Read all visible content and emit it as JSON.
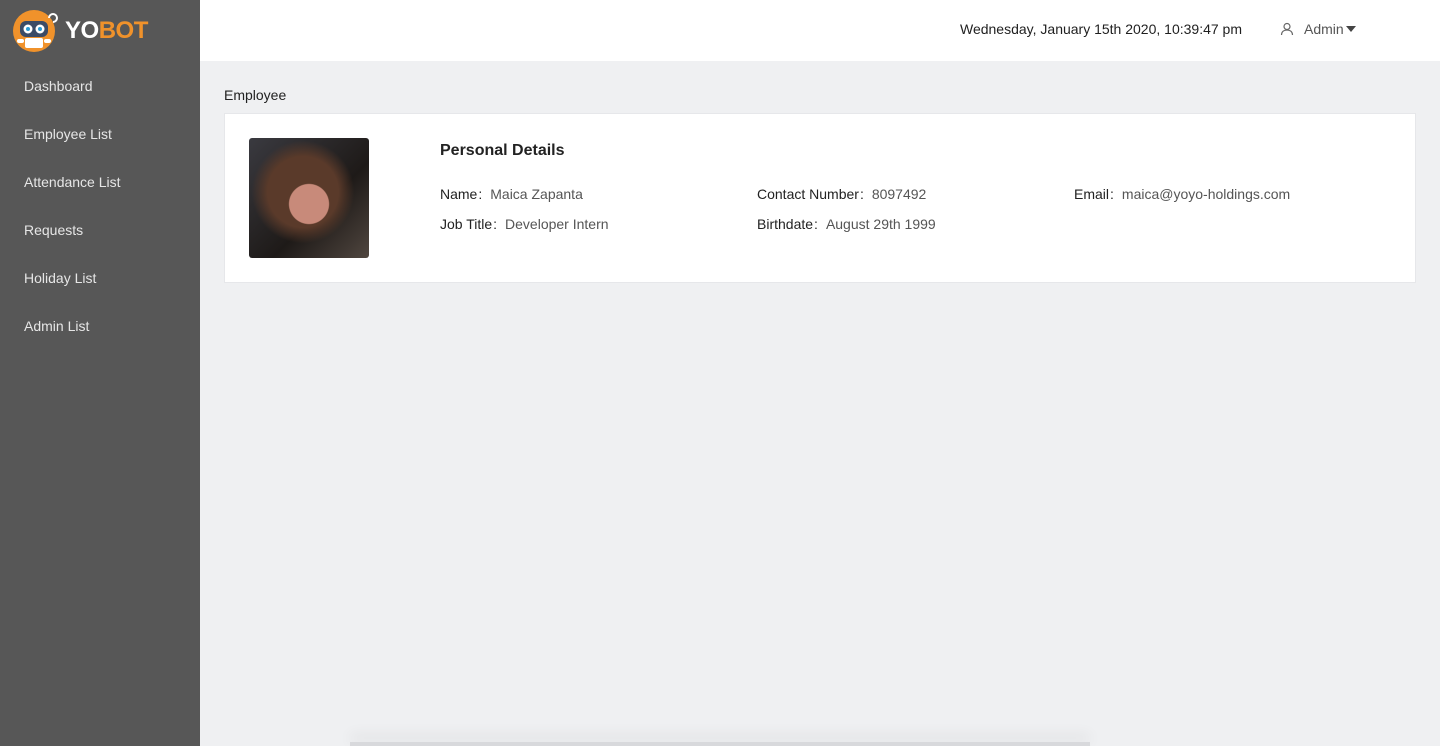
{
  "brand": {
    "part1": "YO",
    "part2": "BOT",
    "accent": "#f0922b"
  },
  "sidebar": {
    "items": [
      {
        "label": "Dashboard"
      },
      {
        "label": "Employee List"
      },
      {
        "label": "Attendance List"
      },
      {
        "label": "Requests"
      },
      {
        "label": "Holiday List"
      },
      {
        "label": "Admin List"
      }
    ]
  },
  "header": {
    "datetime": "Wednesday, January 15th 2020, 10:39:47 pm",
    "user_label": "Admin",
    "user_icon": "user-icon"
  },
  "page": {
    "title": "Employee"
  },
  "employee": {
    "heading": "Personal Details",
    "fields": {
      "name": {
        "label": "Name",
        "value": "Maica Zapanta"
      },
      "job_title": {
        "label": "Job Title",
        "value": "Developer Intern"
      },
      "contact": {
        "label": "Contact Number",
        "value": "8097492"
      },
      "birthdate": {
        "label": "Birthdate",
        "value": "August 29th 1999"
      },
      "email": {
        "label": "Email",
        "value": "maica@yoyo-holdings.com"
      }
    }
  }
}
